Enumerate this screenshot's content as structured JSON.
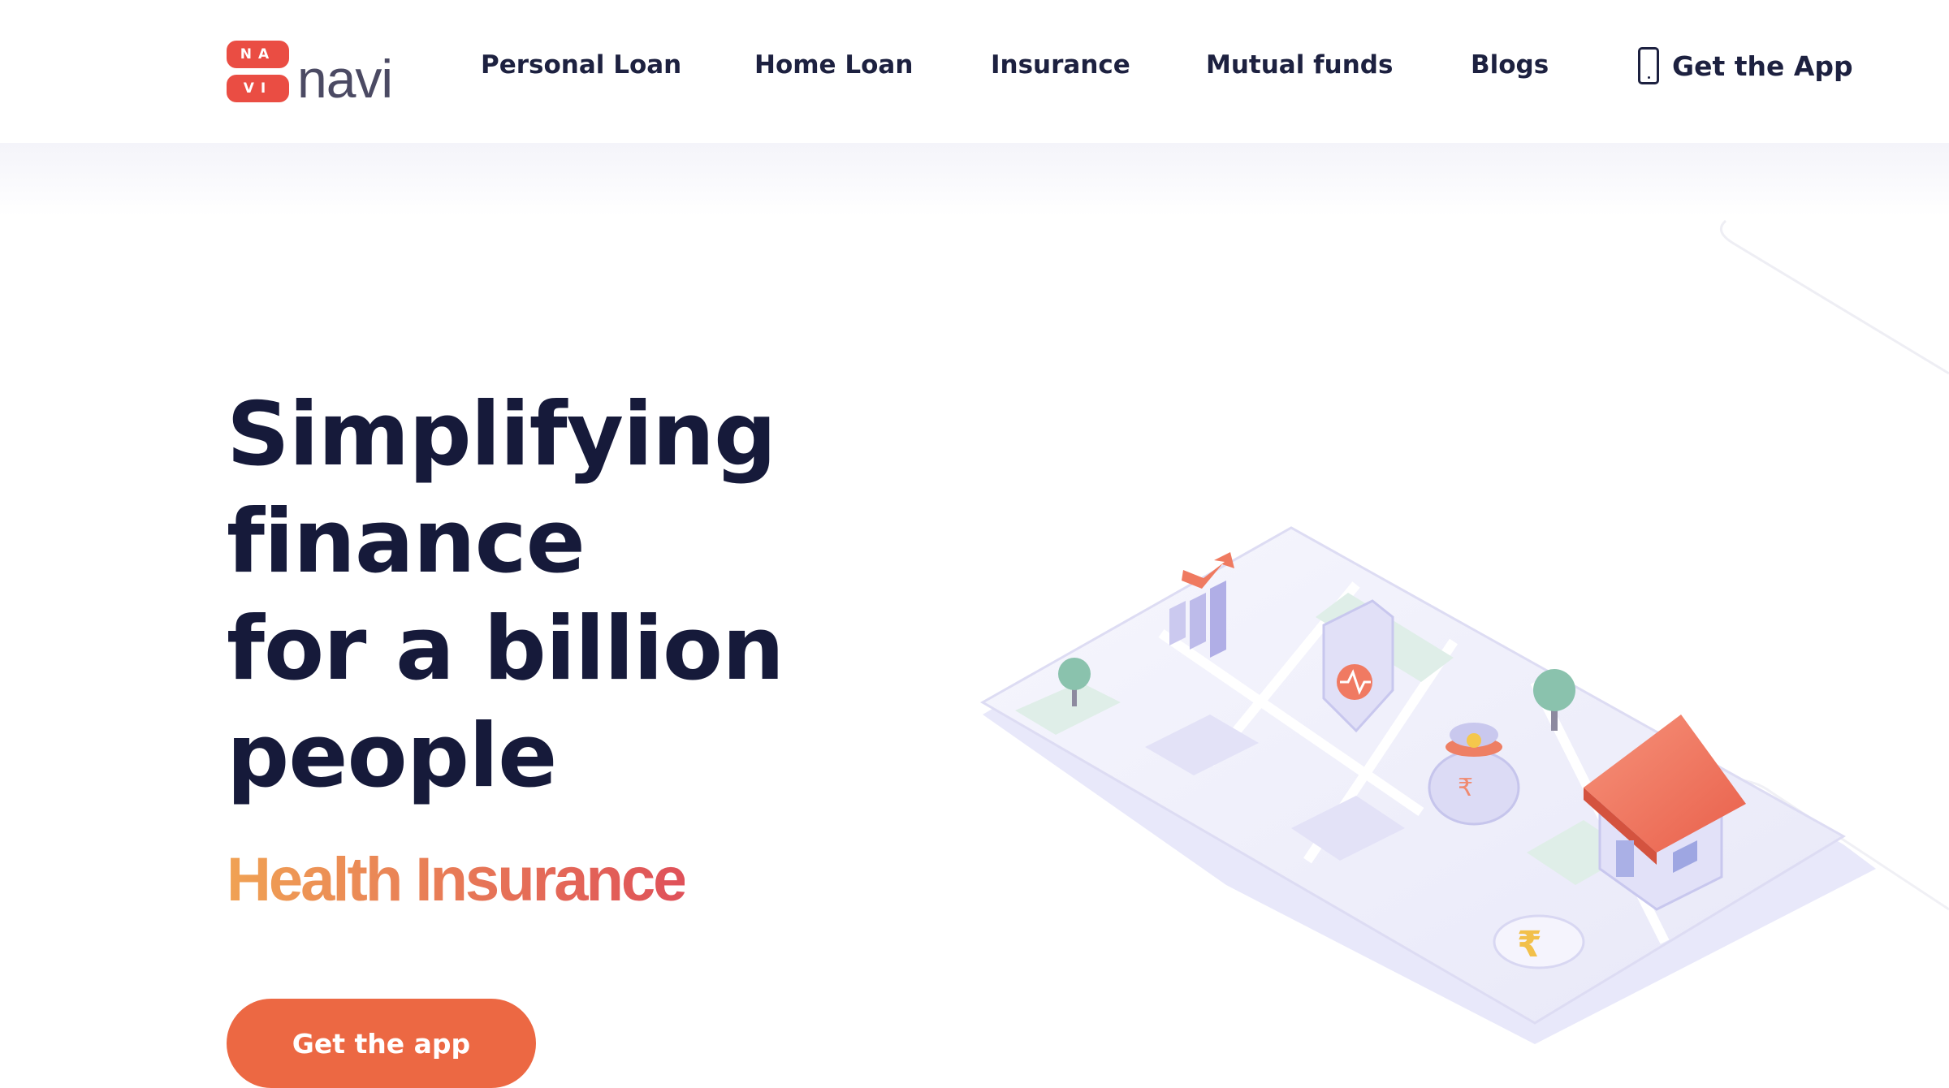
{
  "brand": {
    "logo_letters_top": "NA",
    "logo_letters_bottom": "VI",
    "name": "navi",
    "accent": "#ea4d43",
    "text_dark": "#161a3a"
  },
  "nav": {
    "items": [
      {
        "label": "Personal Loan"
      },
      {
        "label": "Home Loan"
      },
      {
        "label": "Insurance"
      },
      {
        "label": "Mutual funds"
      },
      {
        "label": "Blogs"
      }
    ],
    "app_link": {
      "label": "Get the App",
      "icon": "phone-icon"
    }
  },
  "hero": {
    "title_lines": [
      "Simplifying",
      "finance",
      "for a billion",
      "people"
    ],
    "rotating_text": "Health Insurance",
    "gradient_colors": [
      "#f0a254",
      "#df5159"
    ],
    "cta_label": "Get the app",
    "cta_color": "#ec6843"
  },
  "illustration": {
    "elements": [
      "growth-chart-icon",
      "health-shield-icon",
      "money-bag-icon",
      "house-icon",
      "rupee-coin-icon",
      "tree-icon"
    ]
  }
}
